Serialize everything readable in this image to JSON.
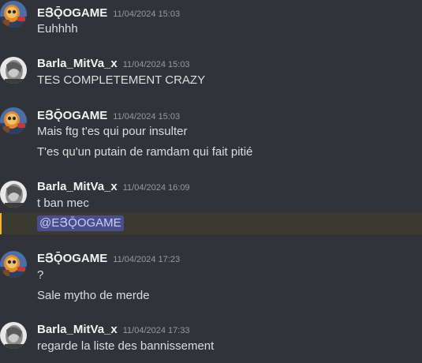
{
  "messages": [
    {
      "username": "EՅǬOGAME",
      "timestamp": "11/04/2024 15:03",
      "lines": [
        "Euhhhh"
      ]
    },
    {
      "username": "Barla_MitVa_x",
      "timestamp": "11/04/2024 15:03",
      "lines": [
        "TES COMPLETEMENT CRAZY"
      ]
    },
    {
      "username": "EՅǬOGAME",
      "timestamp": "11/04/2024 15:03",
      "lines": [
        "Mais ftg t'es qui pour insulter",
        "T'es qu'un putain de ramdam qui fait pitié"
      ]
    },
    {
      "username": "Barla_MitVa_x",
      "timestamp": "11/04/2024 16:09",
      "lines": [
        "t ban mec"
      ],
      "mention": "@EՅǬOGAME"
    },
    {
      "username": "EՅǬOGAME",
      "timestamp": "11/04/2024 17:23",
      "lines": [
        "?",
        "Sale mytho de merde"
      ]
    },
    {
      "username": "Barla_MitVa_x",
      "timestamp": "11/04/2024 17:33",
      "lines": [
        "regarde la liste des bannissement"
      ]
    }
  ],
  "avatars": {
    "entogame": "robot-character-avatar-icon",
    "barla": "grey-portrait-avatar-icon"
  },
  "colors": {
    "background": "#313338",
    "username": "#f2f3f5",
    "timestamp": "#949ba4",
    "text": "#dbdee1",
    "mention_bg": "#4a4f8c",
    "mention_text": "#c9cdfb",
    "mention_highlight": "#3b3a30",
    "mention_bar": "#f0b232"
  }
}
